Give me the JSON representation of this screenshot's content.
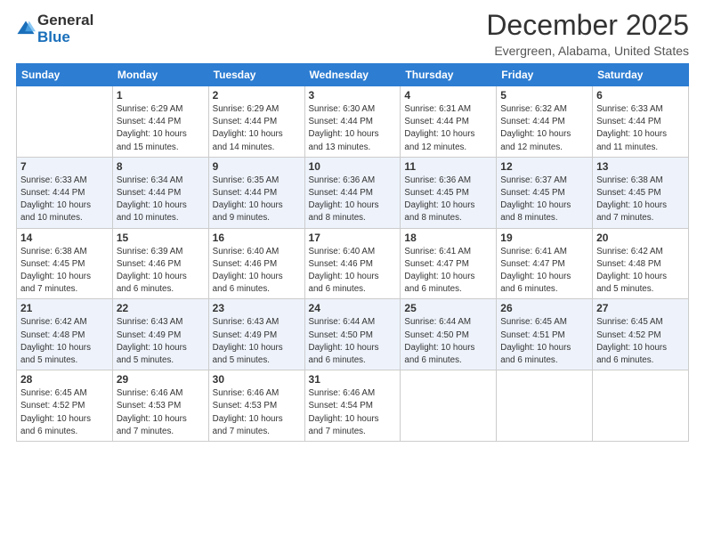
{
  "logo": {
    "general": "General",
    "blue": "Blue"
  },
  "title": "December 2025",
  "location": "Evergreen, Alabama, United States",
  "headers": [
    "Sunday",
    "Monday",
    "Tuesday",
    "Wednesday",
    "Thursday",
    "Friday",
    "Saturday"
  ],
  "weeks": [
    [
      {
        "num": "",
        "info": ""
      },
      {
        "num": "1",
        "info": "Sunrise: 6:29 AM\nSunset: 4:44 PM\nDaylight: 10 hours\nand 15 minutes."
      },
      {
        "num": "2",
        "info": "Sunrise: 6:29 AM\nSunset: 4:44 PM\nDaylight: 10 hours\nand 14 minutes."
      },
      {
        "num": "3",
        "info": "Sunrise: 6:30 AM\nSunset: 4:44 PM\nDaylight: 10 hours\nand 13 minutes."
      },
      {
        "num": "4",
        "info": "Sunrise: 6:31 AM\nSunset: 4:44 PM\nDaylight: 10 hours\nand 12 minutes."
      },
      {
        "num": "5",
        "info": "Sunrise: 6:32 AM\nSunset: 4:44 PM\nDaylight: 10 hours\nand 12 minutes."
      },
      {
        "num": "6",
        "info": "Sunrise: 6:33 AM\nSunset: 4:44 PM\nDaylight: 10 hours\nand 11 minutes."
      }
    ],
    [
      {
        "num": "7",
        "info": "Sunrise: 6:33 AM\nSunset: 4:44 PM\nDaylight: 10 hours\nand 10 minutes."
      },
      {
        "num": "8",
        "info": "Sunrise: 6:34 AM\nSunset: 4:44 PM\nDaylight: 10 hours\nand 10 minutes."
      },
      {
        "num": "9",
        "info": "Sunrise: 6:35 AM\nSunset: 4:44 PM\nDaylight: 10 hours\nand 9 minutes."
      },
      {
        "num": "10",
        "info": "Sunrise: 6:36 AM\nSunset: 4:44 PM\nDaylight: 10 hours\nand 8 minutes."
      },
      {
        "num": "11",
        "info": "Sunrise: 6:36 AM\nSunset: 4:45 PM\nDaylight: 10 hours\nand 8 minutes."
      },
      {
        "num": "12",
        "info": "Sunrise: 6:37 AM\nSunset: 4:45 PM\nDaylight: 10 hours\nand 8 minutes."
      },
      {
        "num": "13",
        "info": "Sunrise: 6:38 AM\nSunset: 4:45 PM\nDaylight: 10 hours\nand 7 minutes."
      }
    ],
    [
      {
        "num": "14",
        "info": "Sunrise: 6:38 AM\nSunset: 4:45 PM\nDaylight: 10 hours\nand 7 minutes."
      },
      {
        "num": "15",
        "info": "Sunrise: 6:39 AM\nSunset: 4:46 PM\nDaylight: 10 hours\nand 6 minutes."
      },
      {
        "num": "16",
        "info": "Sunrise: 6:40 AM\nSunset: 4:46 PM\nDaylight: 10 hours\nand 6 minutes."
      },
      {
        "num": "17",
        "info": "Sunrise: 6:40 AM\nSunset: 4:46 PM\nDaylight: 10 hours\nand 6 minutes."
      },
      {
        "num": "18",
        "info": "Sunrise: 6:41 AM\nSunset: 4:47 PM\nDaylight: 10 hours\nand 6 minutes."
      },
      {
        "num": "19",
        "info": "Sunrise: 6:41 AM\nSunset: 4:47 PM\nDaylight: 10 hours\nand 6 minutes."
      },
      {
        "num": "20",
        "info": "Sunrise: 6:42 AM\nSunset: 4:48 PM\nDaylight: 10 hours\nand 5 minutes."
      }
    ],
    [
      {
        "num": "21",
        "info": "Sunrise: 6:42 AM\nSunset: 4:48 PM\nDaylight: 10 hours\nand 5 minutes."
      },
      {
        "num": "22",
        "info": "Sunrise: 6:43 AM\nSunset: 4:49 PM\nDaylight: 10 hours\nand 5 minutes."
      },
      {
        "num": "23",
        "info": "Sunrise: 6:43 AM\nSunset: 4:49 PM\nDaylight: 10 hours\nand 5 minutes."
      },
      {
        "num": "24",
        "info": "Sunrise: 6:44 AM\nSunset: 4:50 PM\nDaylight: 10 hours\nand 6 minutes."
      },
      {
        "num": "25",
        "info": "Sunrise: 6:44 AM\nSunset: 4:50 PM\nDaylight: 10 hours\nand 6 minutes."
      },
      {
        "num": "26",
        "info": "Sunrise: 6:45 AM\nSunset: 4:51 PM\nDaylight: 10 hours\nand 6 minutes."
      },
      {
        "num": "27",
        "info": "Sunrise: 6:45 AM\nSunset: 4:52 PM\nDaylight: 10 hours\nand 6 minutes."
      }
    ],
    [
      {
        "num": "28",
        "info": "Sunrise: 6:45 AM\nSunset: 4:52 PM\nDaylight: 10 hours\nand 6 minutes."
      },
      {
        "num": "29",
        "info": "Sunrise: 6:46 AM\nSunset: 4:53 PM\nDaylight: 10 hours\nand 7 minutes."
      },
      {
        "num": "30",
        "info": "Sunrise: 6:46 AM\nSunset: 4:53 PM\nDaylight: 10 hours\nand 7 minutes."
      },
      {
        "num": "31",
        "info": "Sunrise: 6:46 AM\nSunset: 4:54 PM\nDaylight: 10 hours\nand 7 minutes."
      },
      {
        "num": "",
        "info": ""
      },
      {
        "num": "",
        "info": ""
      },
      {
        "num": "",
        "info": ""
      }
    ]
  ]
}
